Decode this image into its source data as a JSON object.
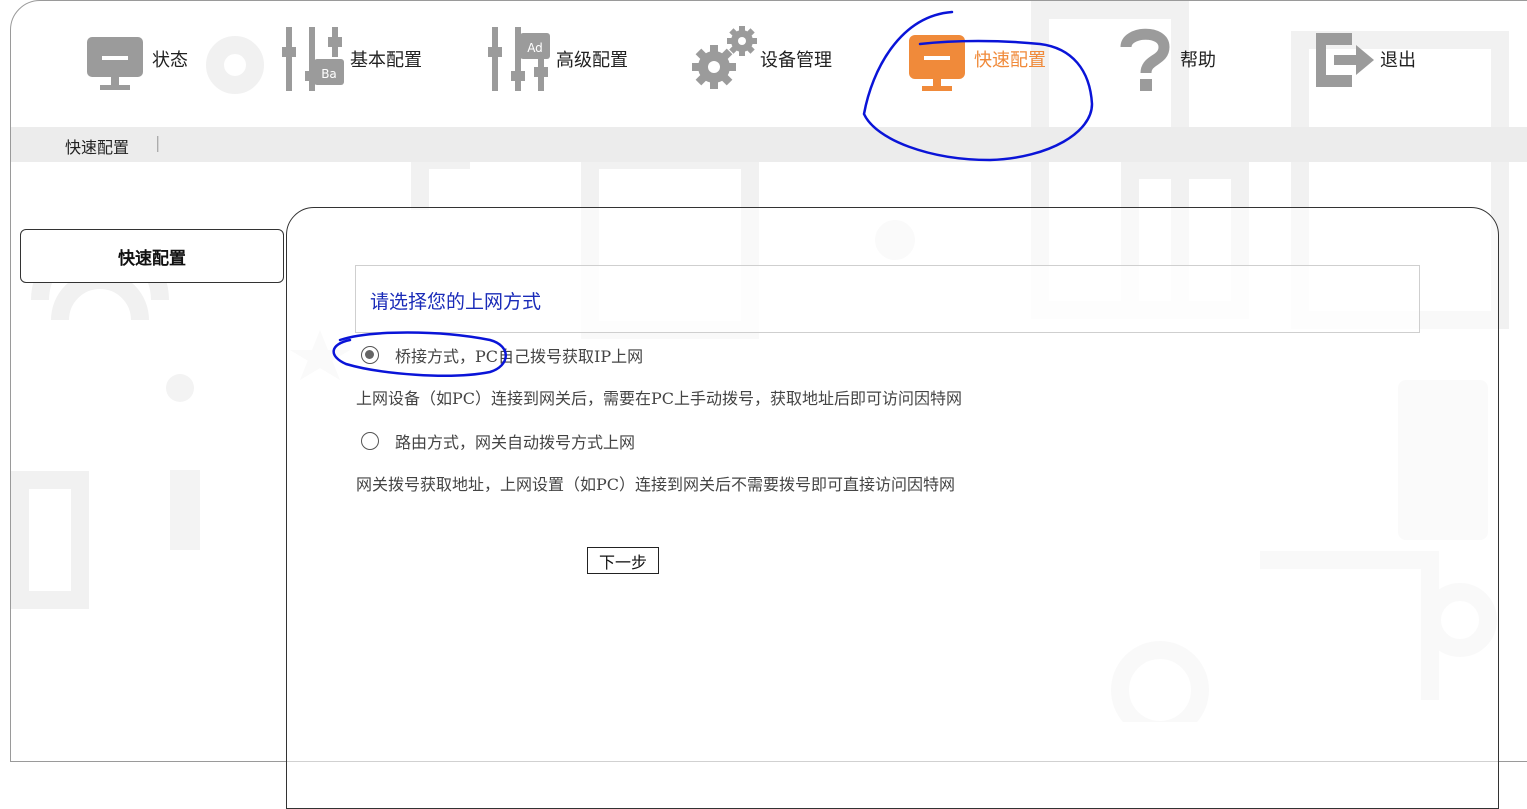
{
  "nav": {
    "items": [
      {
        "label": "状态",
        "icon": "monitor-icon"
      },
      {
        "label": "基本配置",
        "icon": "sliders-basic-icon"
      },
      {
        "label": "高级配置",
        "icon": "sliders-advanced-icon"
      },
      {
        "label": "设备管理",
        "icon": "gears-icon"
      },
      {
        "label": "快速配置",
        "icon": "monitor-icon",
        "active": true
      },
      {
        "label": "帮助",
        "icon": "question-icon"
      },
      {
        "label": "退出",
        "icon": "exit-icon"
      }
    ],
    "icon_badges": {
      "basic": "Ba",
      "advanced": "Ad"
    }
  },
  "breadcrumb": {
    "current": "快速配置",
    "separator": "|"
  },
  "sidebar": {
    "items": [
      {
        "label": "快速配置"
      }
    ]
  },
  "main": {
    "title": "请选择您的上网方式",
    "options": [
      {
        "label": "桥接方式，PC自己拨号获取IP上网",
        "checked": true,
        "description": "上网设备（如PC）连接到网关后，需要在PC上手动拨号，获取地址后即可访问因特网"
      },
      {
        "label": "路由方式，网关自动拨号方式上网",
        "checked": false,
        "description": "网关拨号获取地址，上网设置（如PC）连接到网关后不需要拨号即可直接访问因特网"
      }
    ],
    "next_button": "下一步"
  },
  "colors": {
    "active_nav": "#f08a3a",
    "icon_gray": "#9b9b9b",
    "title_blue": "#1a2bb8",
    "annotation_blue": "#0a14d8"
  }
}
